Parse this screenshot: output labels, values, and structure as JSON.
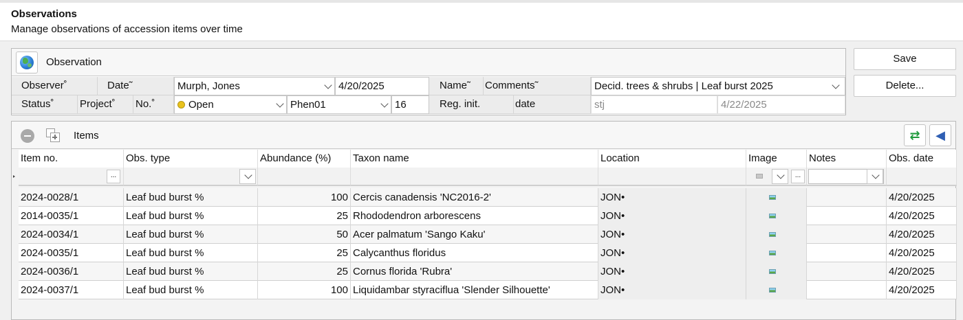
{
  "header": {
    "title": "Observations",
    "subtitle": "Manage observations of accession items over time"
  },
  "observation_panel": {
    "title": "Observation",
    "fields": {
      "observer_label": "Observer˚",
      "date_label": "Date˜",
      "observer_value": "Murph, Jones",
      "date_value": "4/20/2025",
      "name_label": "Name˜",
      "comments_label": "Comments˜",
      "comments_value": "Decid. trees & shrubs | Leaf burst 2025",
      "status_label": "Status˚",
      "project_label": "Project˚",
      "no_label": "No.˚",
      "status_value": "Open",
      "project_value": "Phen01",
      "no_value": "16",
      "reg_init_label": "Reg. init.",
      "reg_date_label": "date",
      "reg_init_value": "stj",
      "reg_date_value": "4/22/2025"
    }
  },
  "actions": {
    "save_label": "Save",
    "delete_label": "Delete..."
  },
  "items_panel": {
    "title": "Items",
    "columns": [
      "Item no.",
      "Obs. type",
      "Abundance (%)",
      "Taxon name",
      "Location",
      "Image",
      "Notes",
      "Obs. date"
    ],
    "filter_ellipsis": "...",
    "rows": [
      {
        "item_no": "2024-0028/1",
        "obs_type": "Leaf bud burst %",
        "abundance": "100",
        "taxon": "Cercis canadensis 'NC2016-2'",
        "location": "JON•",
        "notes": "",
        "obs_date": "4/20/2025"
      },
      {
        "item_no": "2014-0035/1",
        "obs_type": "Leaf bud burst %",
        "abundance": "25",
        "taxon": "Rhododendron arborescens",
        "location": "JON•",
        "notes": "",
        "obs_date": "4/20/2025"
      },
      {
        "item_no": "2024-0034/1",
        "obs_type": "Leaf bud burst %",
        "abundance": "50",
        "taxon": "Acer palmatum 'Sango Kaku'",
        "location": "JON•",
        "notes": "",
        "obs_date": "4/20/2025"
      },
      {
        "item_no": "2024-0035/1",
        "obs_type": "Leaf bud burst %",
        "abundance": "25",
        "taxon": "Calycanthus floridus",
        "location": "JON•",
        "notes": "",
        "obs_date": "4/20/2025"
      },
      {
        "item_no": "2024-0036/1",
        "obs_type": "Leaf bud burst %",
        "abundance": "25",
        "taxon": "Cornus florida 'Rubra'",
        "location": "JON•",
        "notes": "",
        "obs_date": "4/20/2025"
      },
      {
        "item_no": "2024-0037/1",
        "obs_type": "Leaf bud burst %",
        "abundance": "100",
        "taxon": "Liquidambar styraciflua 'Slender Silhouette'",
        "location": "JON•",
        "notes": "",
        "obs_date": "4/20/2025"
      }
    ]
  },
  "icons": {
    "globe": "globe-icon",
    "remove": "minus-circle-icon",
    "add_row": "add-row-icon",
    "refresh": "refresh-icon",
    "speaker": "speaker-icon",
    "image": "image-icon"
  },
  "colors": {
    "status_open": "#e9c21d",
    "refresh": "#1f9a3c",
    "speaker": "#2f5fb3"
  }
}
